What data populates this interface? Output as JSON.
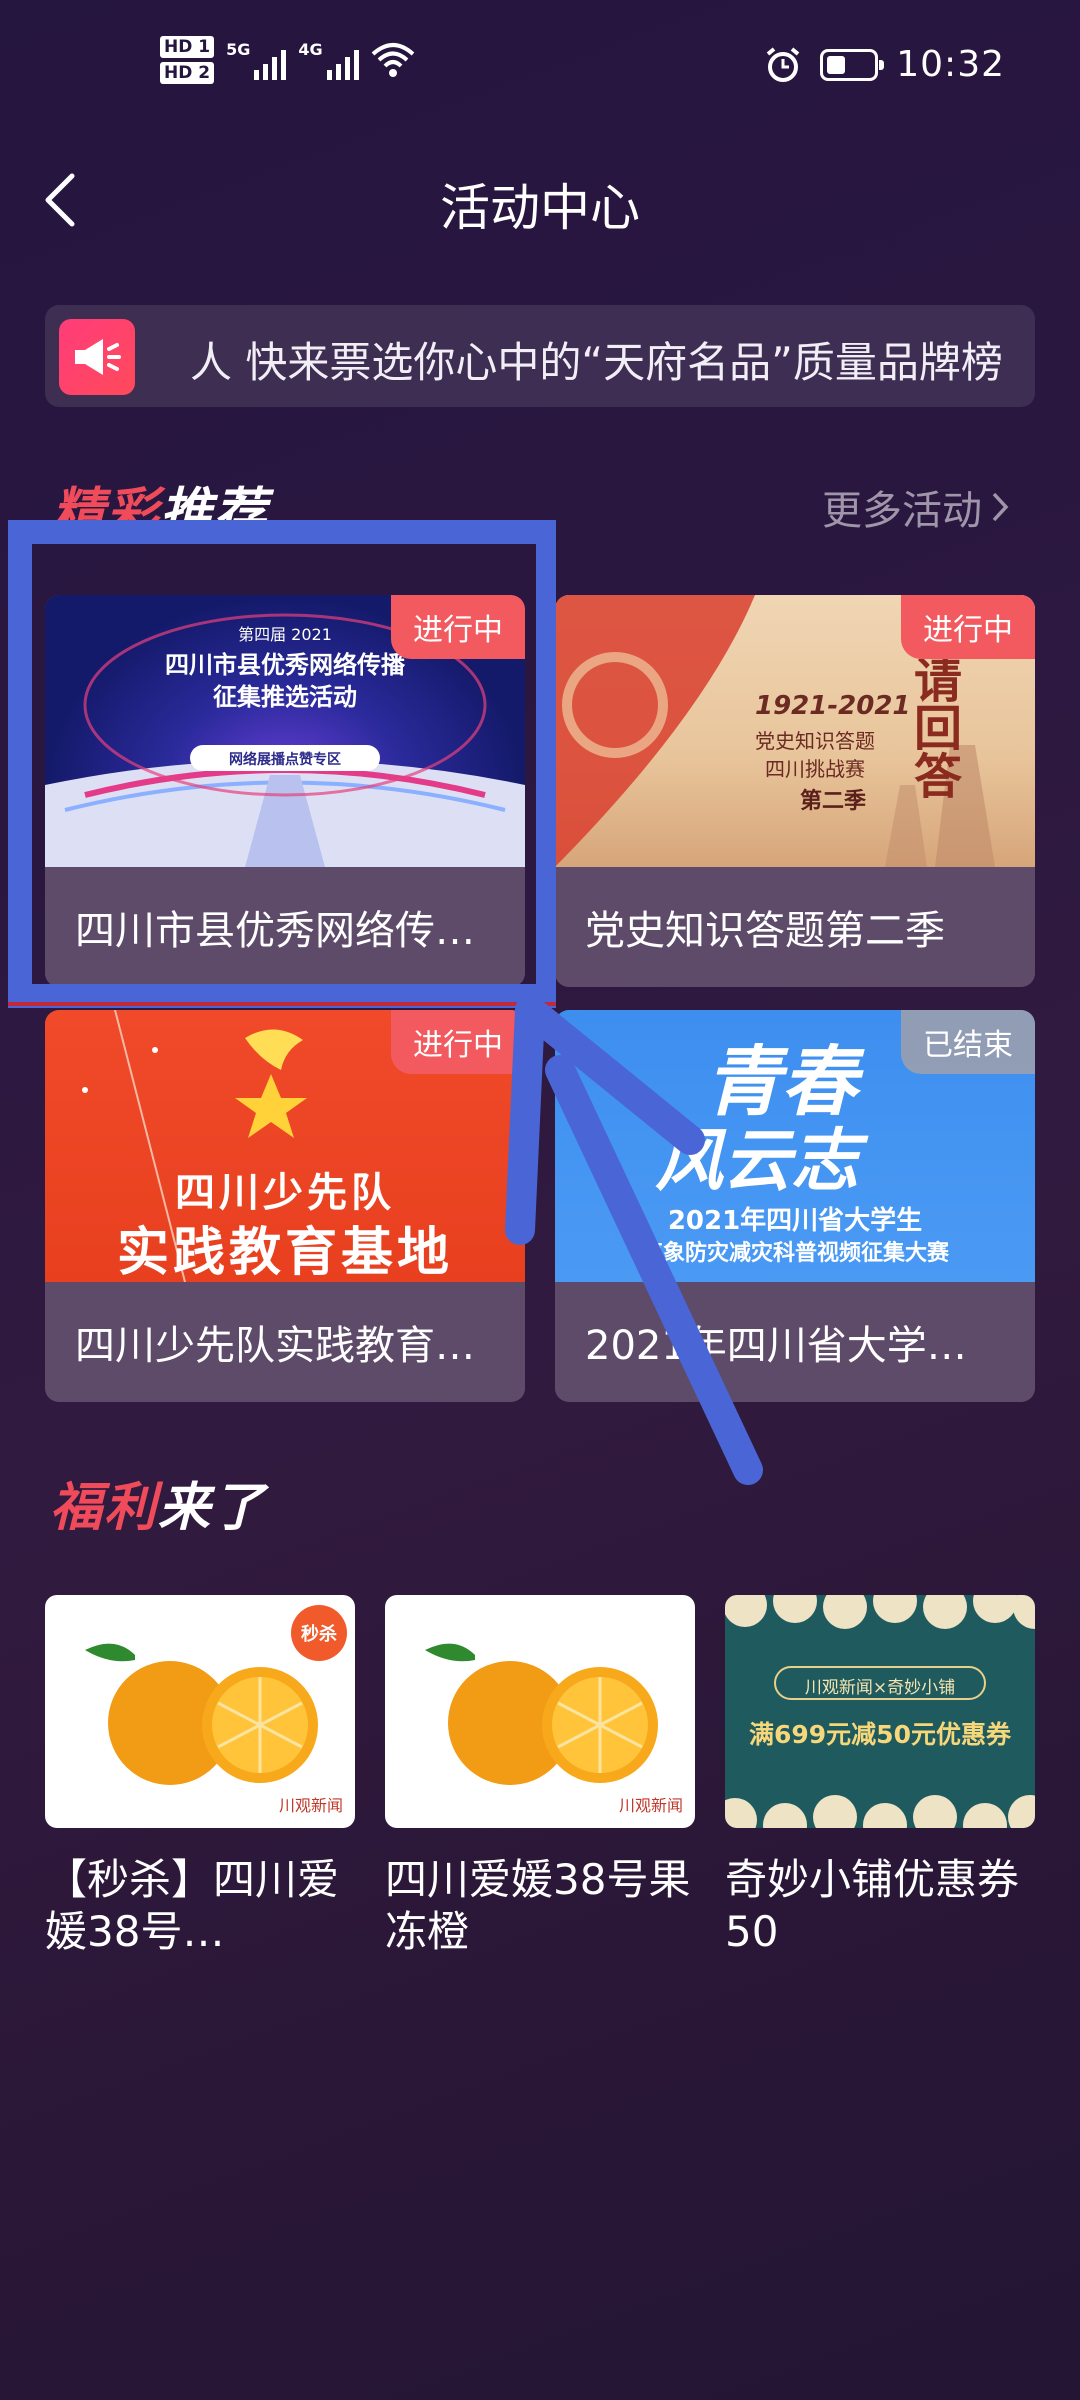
{
  "status_bar": {
    "hd1": "HD 1",
    "hd2": "HD 2",
    "sig1": "5G",
    "sig2": "4G",
    "time": "10:32",
    "battery_level": 0.35
  },
  "header": {
    "title": "活动中心"
  },
  "notice": {
    "text": "人  快来票选你心中的“天府名品”质量品牌榜"
  },
  "featured": {
    "title_accent": "精彩",
    "title_rest": "推荐",
    "more": "更多活动"
  },
  "activities": [
    {
      "title": "四川市县优秀网络传…",
      "status": "进行中",
      "banner_line1": "第四届 2021",
      "banner_line2": "四川市县优秀网络传播",
      "banner_line3": "征集推选活动",
      "banner_btn": "网络展播点赞专区"
    },
    {
      "title": "党史知识答题第二季",
      "status": "进行中",
      "banner_line1": "1921-2021",
      "banner_line2": "党史知识答题",
      "banner_line3": "四川挑战赛",
      "banner_line4": "第二季",
      "banner_side": "请回答"
    },
    {
      "title": "四川少先队实践教育…",
      "status": "进行中",
      "banner_line1": "四川少先队",
      "banner_line2": "实践教育基地"
    },
    {
      "title": "2021年四川省大学…",
      "status": "已结束",
      "banner_line1": "青春",
      "banner_line2": "风云志",
      "banner_line3": "2021年四川省大学生",
      "banner_line4": "气象防灾减灾科普视频征集大赛"
    }
  ],
  "welfare": {
    "title_accent": "福利",
    "title_rest": "来了",
    "items": [
      {
        "name": "【秒杀】四川爱媛38号…",
        "tag": "秒杀",
        "brand": "川观新闻"
      },
      {
        "name": "四川爱媛38号果冻橙",
        "brand": "川观新闻"
      },
      {
        "name": "奇妙小铺优惠券50",
        "coupon_line1": "川观新闻×奇妙小铺",
        "coupon_line2": "满699元减50元优惠券"
      }
    ]
  },
  "colors": {
    "accent": "#f04b5a",
    "active_badge": "#f35a5f",
    "annotation": "#4a66d6"
  }
}
